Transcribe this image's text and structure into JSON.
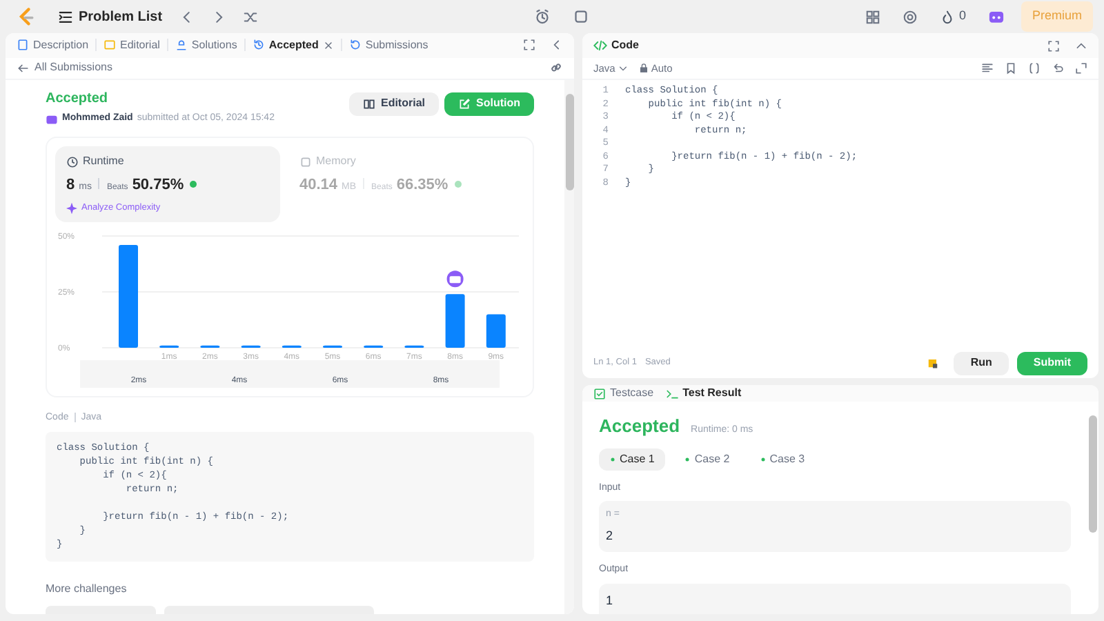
{
  "topbar": {
    "title": "Problem List",
    "streak": "0",
    "premium": "Premium"
  },
  "left_tabs": [
    {
      "label": "Description",
      "selected": false,
      "closable": false
    },
    {
      "label": "Editorial",
      "selected": false,
      "closable": false
    },
    {
      "label": "Solutions",
      "selected": false,
      "closable": false
    },
    {
      "label": "Accepted",
      "selected": true,
      "closable": true
    },
    {
      "label": "Submissions",
      "selected": false,
      "closable": false
    }
  ],
  "back_link": "All Submissions",
  "submission": {
    "status": "Accepted",
    "author": "Mohmmed Zaid",
    "submitted_at": "submitted at Oct 05, 2024 15:42",
    "buttons": [
      {
        "label": "Editorial",
        "kind": "secondary"
      },
      {
        "label": "Solution",
        "kind": "primary"
      }
    ]
  },
  "stats": [
    {
      "title": "Runtime",
      "value": "8",
      "unit": "ms",
      "beats_label": "Beats",
      "beats": "50.75%",
      "selected": true,
      "link": "Analyze Complexity"
    },
    {
      "title": "Memory",
      "value": "40.14",
      "unit": "MB",
      "beats_label": "Beats",
      "beats": "66.35%",
      "selected": false
    }
  ],
  "chart_data": {
    "type": "bar",
    "categories": [
      null,
      "1ms",
      "2ms",
      "3ms",
      "4ms",
      "5ms",
      "6ms",
      "7ms",
      "8ms",
      "9ms"
    ],
    "series": [
      {
        "color": "#0a84ff",
        "values": [
          46,
          1,
          1,
          1,
          1,
          1,
          1,
          1,
          24,
          15
        ]
      }
    ],
    "ylim": [
      0,
      50
    ],
    "yticks": [
      {
        "value": 0,
        "label": "0%"
      },
      {
        "value": 25,
        "label": "25%"
      },
      {
        "value": 50,
        "label": "50%"
      }
    ]
  },
  "range_labels": [
    "2ms",
    "4ms",
    "6ms",
    "8ms"
  ],
  "code_section": {
    "label": "Code",
    "language": "Java",
    "lines": [
      {
        "kind": "code",
        "text": "class Solution {"
      },
      {
        "kind": "code",
        "text": "    public int fib(int n) {"
      },
      {
        "kind": "code",
        "text": "        if (n < 2){"
      },
      {
        "kind": "code",
        "text": "            return n;"
      },
      {
        "kind": "blank"
      },
      {
        "kind": "code",
        "text": "        }return fib(n - 1) + fib(n - 2);"
      },
      {
        "kind": "code",
        "text": "    }"
      },
      {
        "kind": "code",
        "text": "}"
      }
    ]
  },
  "more_challenges": "More challenges",
  "editor": {
    "title": "Code",
    "language": "Java",
    "mode": "Auto",
    "line_numbers": [
      "1",
      "2",
      "3",
      "4",
      "5",
      "6",
      "7",
      "8"
    ],
    "lines": [
      {
        "kind": "code",
        "text": "class Solution {"
      },
      {
        "kind": "code",
        "text": "    public int fib(int n) {"
      },
      {
        "kind": "code",
        "text": "        if (n < 2){"
      },
      {
        "kind": "code",
        "text": "            return n;"
      },
      {
        "kind": "blank"
      },
      {
        "kind": "code",
        "text": "        }return fib(n - 1) + fib(n - 2);"
      },
      {
        "kind": "code",
        "text": "    }"
      },
      {
        "kind": "code",
        "text": "}"
      }
    ],
    "cursor": "Ln 1, Col 1",
    "save_state": "Saved",
    "run": "Run",
    "submit": "Submit"
  },
  "bottom_tabs": [
    {
      "label": "Testcase",
      "selected": false
    },
    {
      "label": "Test Result",
      "selected": true
    }
  ],
  "result": {
    "status": "Accepted",
    "runtime": "Runtime: 0 ms",
    "cases": [
      {
        "label": "Case 1",
        "selected": true
      },
      {
        "label": "Case 2",
        "selected": false
      },
      {
        "label": "Case 3",
        "selected": false
      }
    ],
    "input_label": "Input",
    "input_var": "n =",
    "input_value": "2",
    "output_label": "Output",
    "output_value": "1"
  }
}
